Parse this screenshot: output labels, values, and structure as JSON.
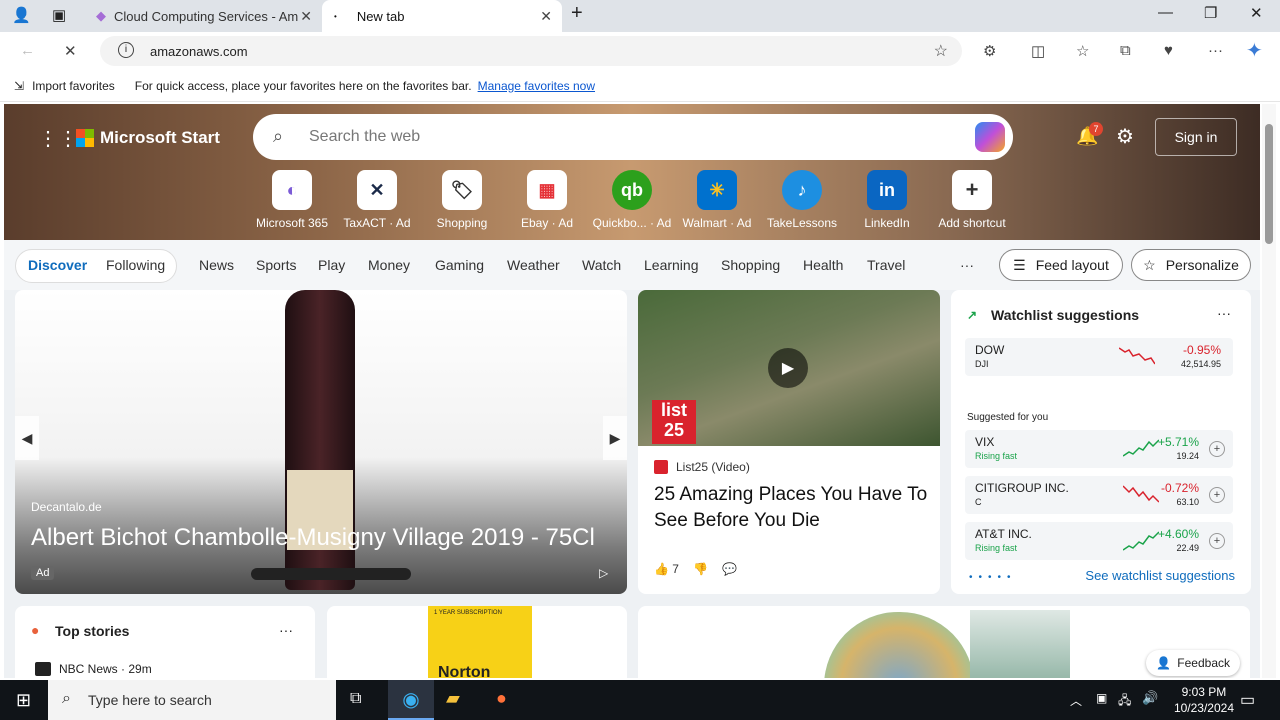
{
  "browser": {
    "tabs": [
      {
        "title": "Cloud Computing Services - Am"
      },
      {
        "title": "New tab"
      }
    ],
    "url": "amazonaws.com",
    "favorites_bar": {
      "import_label": "Import favorites",
      "hint": "For quick access, place your favorites here on the favorites bar.",
      "manage_link": "Manage favorites now"
    }
  },
  "msn": {
    "brand": "Microsoft Start",
    "search_placeholder": "Search the web",
    "notification_count": "7",
    "sign_in": "Sign in",
    "shortcuts": [
      {
        "label": "Microsoft 365",
        "glyph": "◐"
      },
      {
        "label": "TaxACT · Ad",
        "glyph": "✕"
      },
      {
        "label": "Shopping",
        "glyph": "🏷"
      },
      {
        "label": "Ebay · Ad",
        "glyph": "▦"
      },
      {
        "label": "Quickbo... · Ad",
        "glyph": "qb"
      },
      {
        "label": "Walmart · Ad",
        "glyph": "✳"
      },
      {
        "label": "TakeLessons",
        "glyph": "♪"
      },
      {
        "label": "LinkedIn",
        "glyph": "in"
      },
      {
        "label": "Add shortcut",
        "glyph": "+"
      }
    ],
    "nav": {
      "discover": "Discover",
      "following": "Following",
      "items": [
        "News",
        "Sports",
        "Play",
        "Money",
        "Gaming",
        "Weather",
        "Watch",
        "Learning",
        "Shopping",
        "Health",
        "Travel"
      ],
      "more": "···",
      "feed_layout": "Feed layout",
      "personalize": "Personalize"
    },
    "ad_card": {
      "source": "Decantalo.de",
      "title": "Albert Bichot Chambolle-Musigny Village 2019 - 75Cl",
      "badge": "Ad"
    },
    "list_card": {
      "logo": "list 25",
      "source": "List25 (Video)",
      "title": "25 Amazing Places You Have To See Before You Die",
      "likes": "7"
    },
    "watchlist": {
      "title": "Watchlist suggestions",
      "more": "···",
      "dow": {
        "name": "DOW",
        "sub": "DJI",
        "pct": "-0.95%",
        "value": "42,514.95"
      },
      "suggested_label": "Suggested for you",
      "stocks": [
        {
          "name": "VIX",
          "sub": "Rising fast",
          "pct": "+5.71%",
          "value": "19.24",
          "up": true
        },
        {
          "name": "CITIGROUP INC.",
          "sub": "C",
          "pct": "-0.72%",
          "value": "63.10",
          "up": false
        },
        {
          "name": "AT&T INC.",
          "sub": "Rising fast",
          "pct": "+4.60%",
          "value": "22.49",
          "up": true
        }
      ],
      "see_more": "See watchlist suggestions"
    },
    "top_stories": {
      "title": "Top stories",
      "more": "···",
      "first_source": "NBC News · 29m"
    },
    "norton": {
      "tagline": "1 YEAR SUBSCRIPTION",
      "brand": "Norton"
    },
    "feedback": "Feedback"
  },
  "taskbar": {
    "search_placeholder": "Type here to search",
    "time": "9:03 PM",
    "date": "10/23/2024"
  }
}
